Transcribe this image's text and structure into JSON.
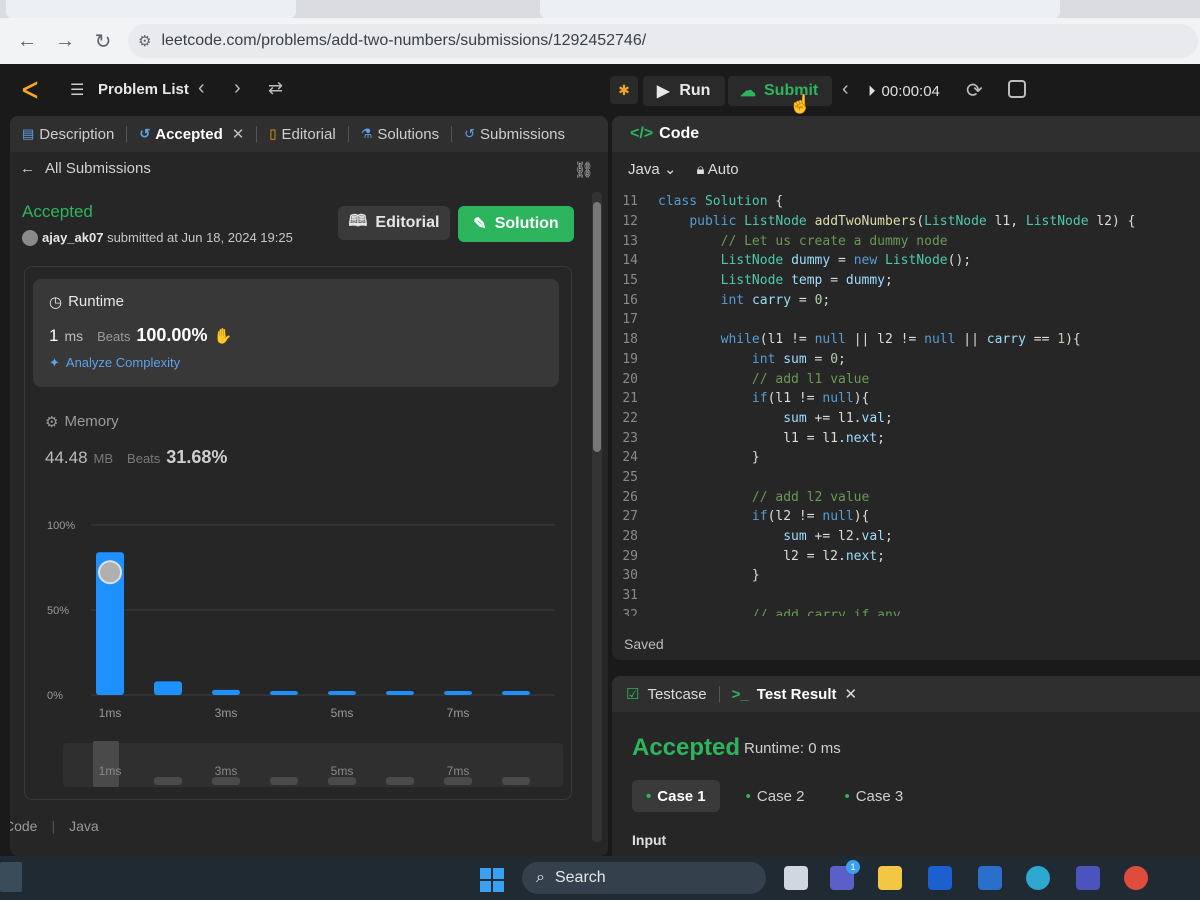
{
  "browser": {
    "url": "leetcode.com/problems/add-two-numbers/submissions/1292452746/"
  },
  "topbar": {
    "problem_list": "Problem List",
    "run": "Run",
    "submit": "Submit",
    "timer": "00:00:04"
  },
  "left": {
    "tabs": [
      "Description",
      "Accepted",
      "Editorial",
      "Solutions",
      "Submissions"
    ],
    "all_submissions": "All Submissions",
    "status": "Accepted",
    "user": "ajay_ak07",
    "submitted_text": "submitted at Jun 18, 2024 19:25",
    "editorial_btn": "Editorial",
    "solution_btn": "Solution",
    "runtime": {
      "title": "Runtime",
      "value": "1",
      "unit": "ms",
      "beats_label": "Beats",
      "beats_pct": "100.00%",
      "analyze": "Analyze Complexity"
    },
    "memory": {
      "title": "Memory",
      "value": "44.48",
      "unit": "MB",
      "beats_label": "Beats",
      "beats_pct": "31.68%"
    },
    "bottom": {
      "code_label": "Code",
      "lang": "Java"
    }
  },
  "chart_data": {
    "type": "bar",
    "title": "",
    "ylabel": "",
    "xlabel": "",
    "ylim": [
      0,
      100
    ],
    "y_ticks": [
      "0%",
      "50%",
      "100%"
    ],
    "x_tick_labels": [
      "1ms",
      "3ms",
      "5ms",
      "7ms"
    ],
    "values": [
      84,
      8,
      3,
      2,
      2,
      2,
      2,
      1
    ],
    "highlight_index": 0,
    "mini_labels": [
      "1ms",
      "3ms",
      "5ms",
      "7ms"
    ],
    "bar_color": "#1e90ff",
    "mini_bar_color": "#4a4a4a"
  },
  "code": {
    "title": "Code",
    "language": "Java",
    "auto": "Auto",
    "saved": "Saved",
    "lines": [
      {
        "n": "11",
        "t": "class Solution {"
      },
      {
        "n": "12",
        "t": "    public ListNode addTwoNumbers(ListNode l1, ListNode l2) {"
      },
      {
        "n": "13",
        "t": "        // Let us create a dummy node"
      },
      {
        "n": "14",
        "t": "        ListNode dummy = new ListNode();"
      },
      {
        "n": "15",
        "t": "        ListNode temp = dummy;"
      },
      {
        "n": "16",
        "t": "        int carry = 0;"
      },
      {
        "n": "17",
        "t": ""
      },
      {
        "n": "18",
        "t": "        while(l1 != null || l2 != null || carry == 1){"
      },
      {
        "n": "19",
        "t": "            int sum = 0;"
      },
      {
        "n": "20",
        "t": "            // add l1 value"
      },
      {
        "n": "21",
        "t": "            if(l1 != null){"
      },
      {
        "n": "22",
        "t": "                sum += l1.val;"
      },
      {
        "n": "23",
        "t": "                l1 = l1.next;"
      },
      {
        "n": "24",
        "t": "            }"
      },
      {
        "n": "25",
        "t": ""
      },
      {
        "n": "26",
        "t": "            // add l2 value"
      },
      {
        "n": "27",
        "t": "            if(l2 != null){"
      },
      {
        "n": "28",
        "t": "                sum += l2.val;"
      },
      {
        "n": "29",
        "t": "                l2 = l2.next;"
      },
      {
        "n": "30",
        "t": "            }"
      },
      {
        "n": "31",
        "t": ""
      },
      {
        "n": "32",
        "t": "            // add carry if any"
      }
    ]
  },
  "test": {
    "tab_testcase": "Testcase",
    "tab_result": "Test Result",
    "status": "Accepted",
    "runtime": "Runtime: 0 ms",
    "cases": [
      "Case 1",
      "Case 2",
      "Case 3"
    ],
    "input_label": "Input"
  },
  "taskbar": {
    "search": "Search",
    "badge": "1"
  }
}
